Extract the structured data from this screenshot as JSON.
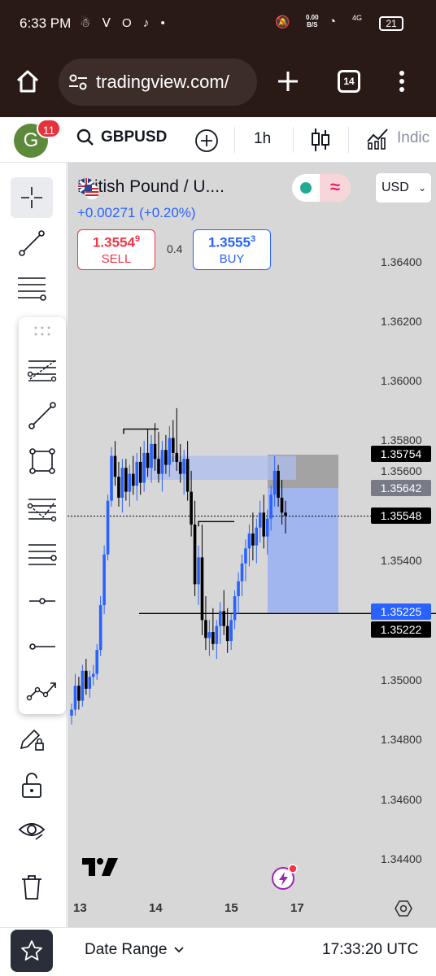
{
  "status_bar": {
    "time": "6:33 PM",
    "left_icons": "☃ ᐯ O ♪ •",
    "net_speed": "0.00",
    "net_unit": "B/S",
    "network": "4G",
    "battery": "21"
  },
  "browser": {
    "url": "tradingview.com/",
    "tab_count": "14"
  },
  "toolbar": {
    "notification_count": "11",
    "avatar_letter": "G",
    "symbol": "GBPUSD",
    "interval": "1h",
    "indicators_label": "Indic"
  },
  "chart_header": {
    "title": "British Pound / U....",
    "change": "+0.00271 (+0.20%)",
    "currency": "USD",
    "sell_price_main": "1.3554",
    "sell_price_small": "9",
    "sell_label": "SELL",
    "spread": "0.4",
    "buy_price_main": "1.3555",
    "buy_price_small": "3",
    "buy_label": "BUY"
  },
  "price_axis": {
    "labels": [
      "1.36400",
      "1.36200",
      "1.36000",
      "1.35800",
      "1.35600",
      "1.35400",
      "1.35000",
      "1.34800",
      "1.34600",
      "1.34400"
    ],
    "tags": [
      "1.35754",
      "1.35642",
      "1.35548",
      "1.35225",
      "1.35222"
    ]
  },
  "time_axis": {
    "labels": [
      "13",
      "14",
      "15",
      "17"
    ]
  },
  "bottom_bar": {
    "range_label": "Date Range",
    "clock": "17:33:20 UTC"
  },
  "colors": {
    "accent": "#2962ff",
    "sell": "#f23645",
    "live": "#22ab94",
    "chart_bg": "#d7d7d7"
  },
  "chart_data": {
    "type": "candlestick",
    "symbol": "GBPUSD",
    "interval": "1h",
    "ylim": [
      1.343,
      1.3665
    ],
    "x_labels": [
      "13",
      "14",
      "15",
      "17"
    ],
    "last_price": 1.35548,
    "position_tool": {
      "entry": 1.35642,
      "target": 1.35754,
      "stop": 1.35225
    },
    "horizontal_line": 1.35222,
    "candles": [
      [
        1.3488,
        1.3492,
        1.3485,
        1.349
      ],
      [
        1.349,
        1.3502,
        1.3488,
        1.3498
      ],
      [
        1.3498,
        1.3501,
        1.349,
        1.3493
      ],
      [
        1.3493,
        1.3505,
        1.3491,
        1.3503
      ],
      [
        1.3503,
        1.3507,
        1.3495,
        1.3497
      ],
      [
        1.3497,
        1.3503,
        1.3494,
        1.3501
      ],
      [
        1.3501,
        1.3505,
        1.3498,
        1.3502
      ],
      [
        1.3502,
        1.3512,
        1.35,
        1.351
      ],
      [
        1.351,
        1.3528,
        1.3508,
        1.3525
      ],
      [
        1.3525,
        1.3545,
        1.3522,
        1.3542
      ],
      [
        1.3542,
        1.3562,
        1.354,
        1.356
      ],
      [
        1.356,
        1.3578,
        1.3558,
        1.3575
      ],
      [
        1.3575,
        1.358,
        1.3565,
        1.3568
      ],
      [
        1.3568,
        1.3573,
        1.3558,
        1.3561
      ],
      [
        1.3561,
        1.3574,
        1.3556,
        1.3571
      ],
      [
        1.3571,
        1.3574,
        1.356,
        1.3563
      ],
      [
        1.3563,
        1.3572,
        1.3558,
        1.3569
      ],
      [
        1.3569,
        1.3575,
        1.3562,
        1.3565
      ],
      [
        1.3565,
        1.3576,
        1.356,
        1.3573
      ],
      [
        1.3573,
        1.3578,
        1.3562,
        1.3566
      ],
      [
        1.3566,
        1.358,
        1.3563,
        1.3576
      ],
      [
        1.3576,
        1.3584,
        1.3568,
        1.3571
      ],
      [
        1.3571,
        1.3582,
        1.3566,
        1.3579
      ],
      [
        1.3579,
        1.3586,
        1.357,
        1.3574
      ],
      [
        1.3574,
        1.3583,
        1.3566,
        1.3569
      ],
      [
        1.3569,
        1.358,
        1.3563,
        1.3577
      ],
      [
        1.3577,
        1.3582,
        1.3569,
        1.3572
      ],
      [
        1.3572,
        1.3585,
        1.3568,
        1.3581
      ],
      [
        1.3581,
        1.3587,
        1.3573,
        1.3576
      ],
      [
        1.3576,
        1.3591,
        1.357,
        1.3573
      ],
      [
        1.3573,
        1.3579,
        1.3566,
        1.3569
      ],
      [
        1.3569,
        1.3577,
        1.3562,
        1.3574
      ],
      [
        1.3574,
        1.358,
        1.356,
        1.3563
      ],
      [
        1.3563,
        1.357,
        1.3548,
        1.3552
      ],
      [
        1.3552,
        1.356,
        1.3528,
        1.3532
      ],
      [
        1.3532,
        1.3545,
        1.3525,
        1.3541
      ],
      [
        1.3541,
        1.3552,
        1.3515,
        1.352
      ],
      [
        1.352,
        1.3528,
        1.351,
        1.3514
      ],
      [
        1.3514,
        1.352,
        1.3508,
        1.3516
      ],
      [
        1.3516,
        1.3524,
        1.351,
        1.3512
      ],
      [
        1.3512,
        1.352,
        1.3507,
        1.3518
      ],
      [
        1.3518,
        1.3526,
        1.3512,
        1.3523
      ],
      [
        1.3523,
        1.353,
        1.3515,
        1.3518
      ],
      [
        1.3518,
        1.3524,
        1.3509,
        1.3513
      ],
      [
        1.3513,
        1.3522,
        1.351,
        1.352
      ],
      [
        1.352,
        1.353,
        1.3517,
        1.3528
      ],
      [
        1.3528,
        1.3536,
        1.3522,
        1.3533
      ],
      [
        1.3533,
        1.3542,
        1.3528,
        1.3539
      ],
      [
        1.3539,
        1.3547,
        1.3533,
        1.3544
      ],
      [
        1.3544,
        1.3552,
        1.3538,
        1.3549
      ],
      [
        1.3549,
        1.3556,
        1.354,
        1.3545
      ],
      [
        1.3545,
        1.3554,
        1.3539,
        1.3551
      ],
      [
        1.3551,
        1.356,
        1.3546,
        1.3556
      ],
      [
        1.3556,
        1.3562,
        1.3544,
        1.3548
      ],
      [
        1.3548,
        1.3557,
        1.3542,
        1.3554
      ],
      [
        1.3554,
        1.3565,
        1.355,
        1.3562
      ],
      [
        1.3562,
        1.3575,
        1.3558,
        1.357
      ],
      [
        1.357,
        1.3572,
        1.3558,
        1.3561
      ],
      [
        1.3561,
        1.3567,
        1.3552,
        1.3556
      ],
      [
        1.3556,
        1.356,
        1.3549,
        1.3555
      ]
    ]
  }
}
